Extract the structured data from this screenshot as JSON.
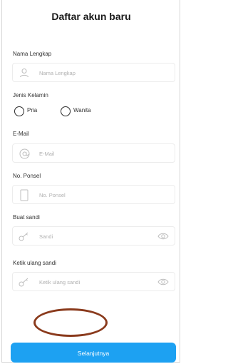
{
  "header": {
    "title": "Daftar akun baru"
  },
  "form": {
    "name": {
      "label": "Nama Lengkap",
      "placeholder": "Nama Lengkap",
      "icon": "user-icon"
    },
    "gender": {
      "label": "Jenis Kelamin",
      "options": [
        {
          "label": "Pria"
        },
        {
          "label": "Wanita"
        }
      ]
    },
    "email": {
      "label": "E-Mail",
      "placeholder": "E-Mail",
      "icon": "at-icon"
    },
    "phone": {
      "label": "No. Ponsel",
      "placeholder": "No. Ponsel",
      "icon": "phone-icon"
    },
    "password": {
      "label": "Buat sandi",
      "placeholder": "Sandi",
      "icon": "key-icon",
      "toggle_icon": "eye-icon"
    },
    "confirm_password": {
      "label": "Ketik ulang sandi",
      "placeholder": "Ketik ulang sandi",
      "icon": "key-icon",
      "toggle_icon": "eye-icon"
    }
  },
  "footer": {
    "next_label": "Selanjutnya",
    "accent": "#1da1f2",
    "annotation_color": "#8a3a1c"
  }
}
